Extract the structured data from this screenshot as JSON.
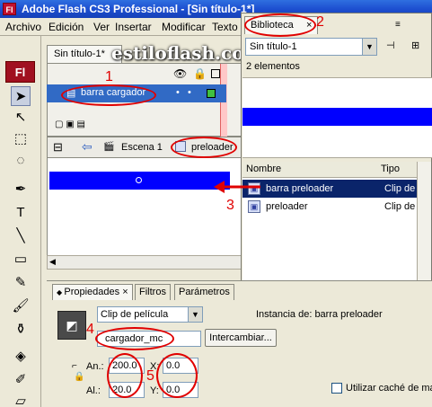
{
  "window": {
    "title": "Adobe Flash CS3 Professional - [Sin título-1*]",
    "app_icon": "Fl"
  },
  "menu": [
    "Archivo",
    "Edición",
    "Ver",
    "Insertar",
    "Modificar",
    "Texto"
  ],
  "tools": {
    "logo": "Fl"
  },
  "document": {
    "tab": "Sin título-1*",
    "layer": "barra cargador",
    "scene": "Escena 1",
    "symbol": "preloader"
  },
  "watermark": "estiloflash.com",
  "library": {
    "tab": "Biblioteca",
    "close": "×",
    "selected_doc": "Sin título-1",
    "count": "2 elementos",
    "columns": {
      "name": "Nombre",
      "type": "Tipo"
    },
    "items": [
      {
        "name": "barra preloader",
        "type": "Clip de"
      },
      {
        "name": "preloader",
        "type": "Clip de"
      }
    ]
  },
  "properties": {
    "tabs": [
      "Propiedades",
      "Filtros",
      "Parámetros"
    ],
    "symbol_type": "Clip de película",
    "instance_name": "cargador_mc",
    "swap_button": "Intercambiar...",
    "instance_of_label": "Instancia de:",
    "instance_of_value": "barra preloader",
    "width_label": "An.:",
    "height_label": "Al.:",
    "x_label": "X:",
    "y_label": "Y:",
    "width": "200.0",
    "height": "20.0",
    "x": "0.0",
    "y": "0.0",
    "cache_label": "Utilizar caché de ma"
  },
  "annotations": [
    "1",
    "2",
    "3",
    "4",
    "5"
  ],
  "colors": {
    "accent_blue": "#0000ff",
    "annotation_red": "#e00000",
    "selection": "#0a246a"
  }
}
